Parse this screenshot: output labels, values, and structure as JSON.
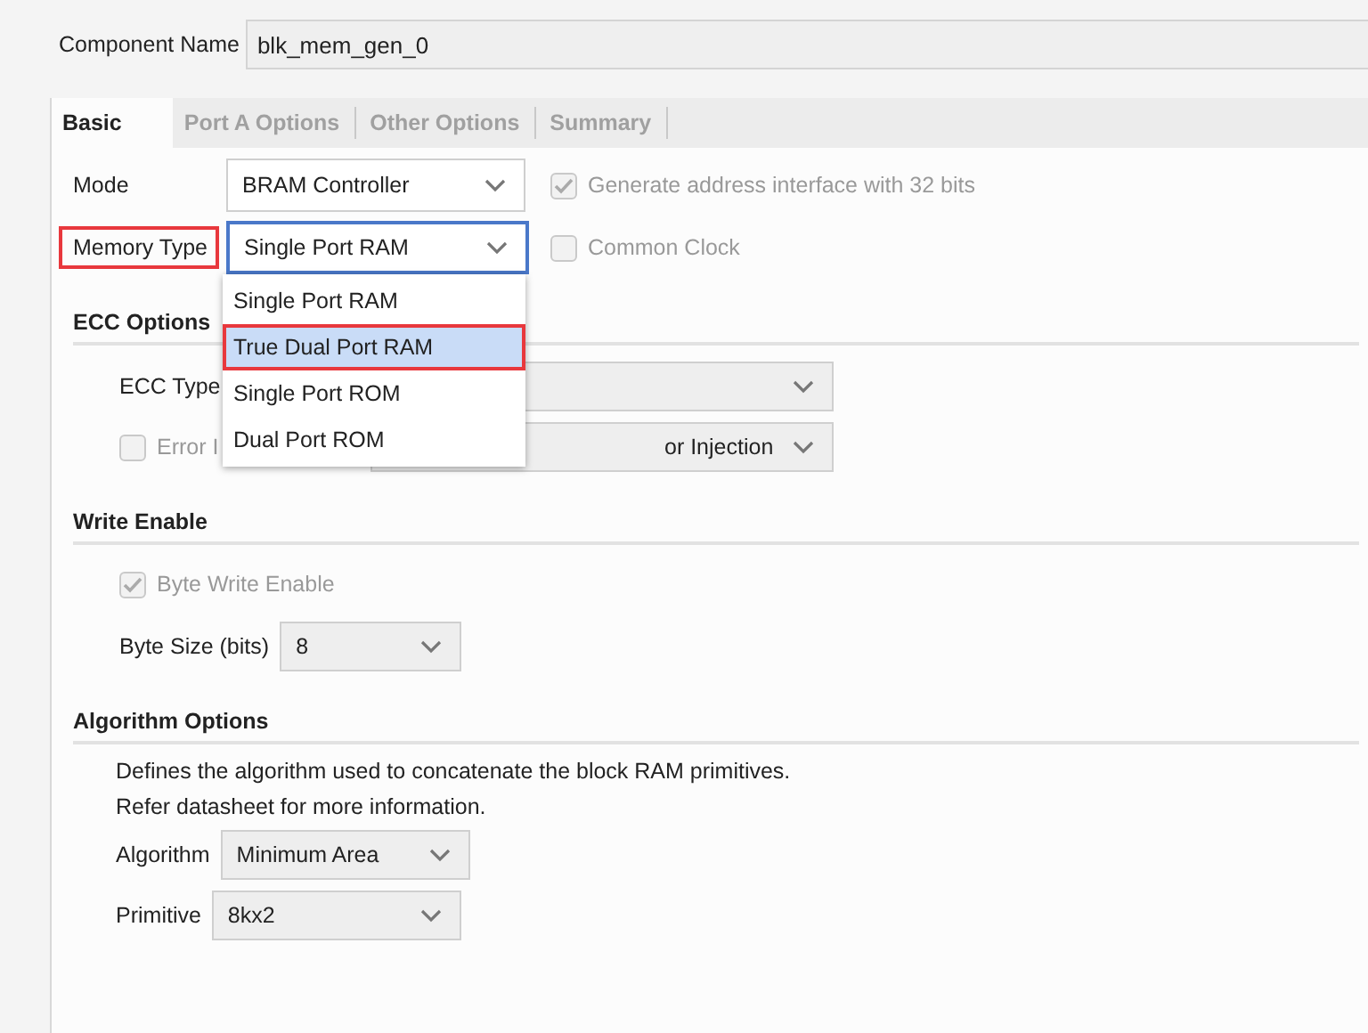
{
  "component_name": {
    "label": "Component Name",
    "value": "blk_mem_gen_0"
  },
  "tabs": [
    {
      "label": "Basic",
      "selected": true
    },
    {
      "label": "Port A Options",
      "selected": false
    },
    {
      "label": "Other Options",
      "selected": false
    },
    {
      "label": "Summary",
      "selected": false
    }
  ],
  "mode": {
    "label": "Mode",
    "value": "BRAM Controller",
    "option": {
      "label": "Generate address interface with 32 bits",
      "checked": true,
      "disabled": true
    }
  },
  "memory_type": {
    "label": "Memory Type",
    "value": "Single Port RAM",
    "highlighted": true,
    "expanded": true,
    "options": [
      {
        "label": "Single Port RAM",
        "hovered": false,
        "highlighted": false
      },
      {
        "label": "True Dual Port RAM",
        "hovered": true,
        "highlighted": true
      },
      {
        "label": "Single Port ROM",
        "hovered": false,
        "highlighted": false
      },
      {
        "label": "Dual Port ROM",
        "hovered": false,
        "highlighted": false
      }
    ],
    "option": {
      "label": "Common Clock",
      "checked": false,
      "disabled": true
    }
  },
  "sections": [
    {
      "title": "ECC Options",
      "items": [
        {
          "kind": "dropdown",
          "label": "ECC Type",
          "disabled": true
        },
        {
          "kind": "check-dropdown",
          "label": "Error I",
          "checked": false,
          "disabled": true,
          "value": "or Injection"
        }
      ]
    },
    {
      "title": "Write Enable",
      "items": [
        {
          "kind": "checkbox",
          "label": "Byte Write Enable",
          "checked": true,
          "disabled": true
        },
        {
          "kind": "dropdown",
          "label": "Byte Size (bits)",
          "value": "8",
          "disabled": true
        }
      ]
    },
    {
      "title": "Algorithm Options",
      "items": [
        {
          "kind": "text",
          "text": "Defines the algorithm used to concatenate the block RAM primitives."
        },
        {
          "kind": "text",
          "text": "Refer datasheet for more information."
        },
        {
          "kind": "dropdown",
          "label": "Algorithm",
          "value": "Minimum Area",
          "disabled": true
        },
        {
          "kind": "dropdown",
          "label": "Primitive",
          "value": "8kx2",
          "disabled": true
        }
      ]
    }
  ]
}
